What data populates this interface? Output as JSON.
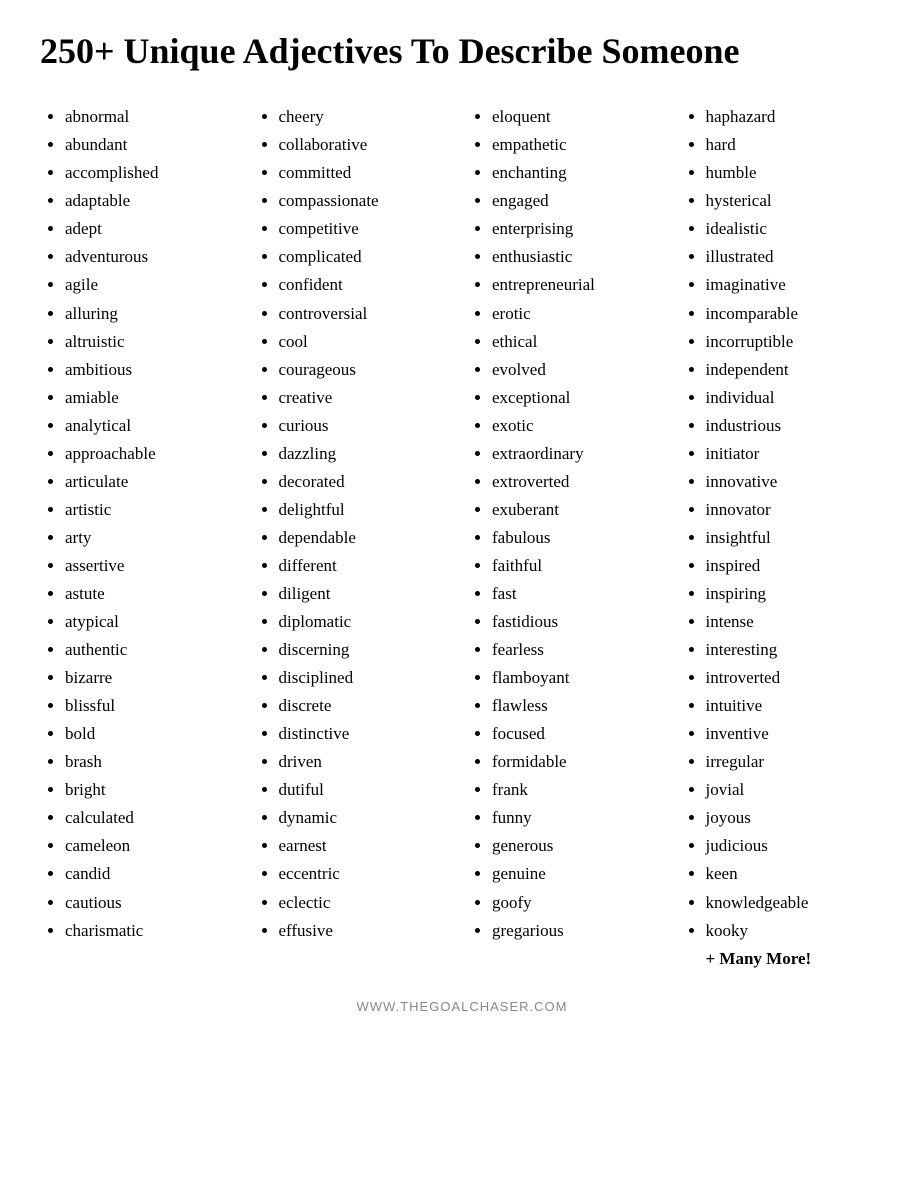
{
  "title": "250+ Unique Adjectives To Describe Someone",
  "columns": [
    {
      "id": "col1",
      "items": [
        "abnormal",
        "abundant",
        "accomplished",
        "adaptable",
        "adept",
        "adventurous",
        "agile",
        "alluring",
        "altruistic",
        "ambitious",
        "amiable",
        "analytical",
        "approachable",
        "articulate",
        "artistic",
        "arty",
        "assertive",
        "astute",
        "atypical",
        "authentic",
        "bizarre",
        "blissful",
        "bold",
        "brash",
        "bright",
        "calculated",
        "cameleon",
        "candid",
        "cautious",
        "charismatic"
      ]
    },
    {
      "id": "col2",
      "items": [
        "cheery",
        "collaborative",
        "committed",
        "compassionate",
        "competitive",
        "complicated",
        "confident",
        "controversial",
        "cool",
        "courageous",
        "creative",
        "curious",
        "dazzling",
        "decorated",
        "delightful",
        "dependable",
        "different",
        "diligent",
        "diplomatic",
        "discerning",
        "disciplined",
        "discrete",
        "distinctive",
        "driven",
        "dutiful",
        "dynamic",
        "earnest",
        "eccentric",
        "eclectic",
        "effusive"
      ]
    },
    {
      "id": "col3",
      "items": [
        "eloquent",
        "empathetic",
        "enchanting",
        "engaged",
        "enterprising",
        "enthusiastic",
        "entrepreneurial",
        "erotic",
        "ethical",
        "evolved",
        "exceptional",
        "exotic",
        "extraordinary",
        "extroverted",
        "exuberant",
        "fabulous",
        "faithful",
        "fast",
        "fastidious",
        "fearless",
        "flamboyant",
        "flawless",
        "focused",
        "formidable",
        "frank",
        "funny",
        "generous",
        "genuine",
        "goofy",
        "gregarious"
      ]
    },
    {
      "id": "col4",
      "items": [
        "haphazard",
        "hard",
        "humble",
        "hysterical",
        "idealistic",
        "illustrated",
        "imaginative",
        "incomparable",
        "incorruptible",
        "independent",
        "individual",
        "industrious",
        "initiator",
        "innovative",
        "innovator",
        "insightful",
        "inspired",
        "inspiring",
        "intense",
        "interesting",
        "introverted",
        "intuitive",
        "inventive",
        "irregular",
        "jovial",
        "joyous",
        "judicious",
        "keen",
        "knowledgeable",
        "kooky"
      ],
      "suffix": "+ Many More!"
    }
  ],
  "footer": "WWW.THEGOALCHASER.COM"
}
